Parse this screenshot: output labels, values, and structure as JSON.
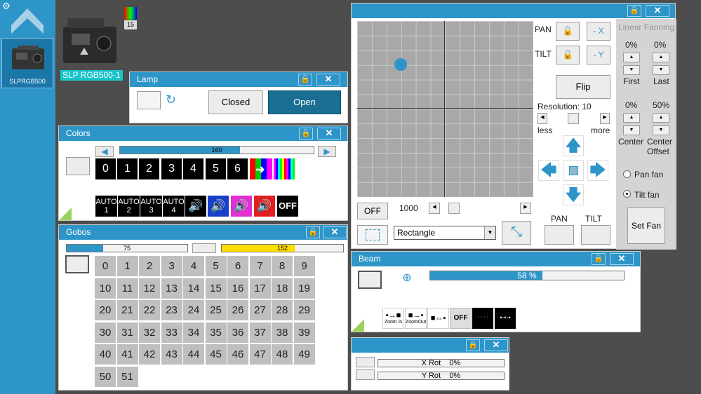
{
  "colors_theme": {
    "accent": "#2e95c8",
    "panel_bg": "#ffffff",
    "yellow": "#ffdd00",
    "dark_blue": "#1b6e93"
  },
  "sidebar": {
    "fixture_label": "SLPRGB500"
  },
  "fixture": {
    "name": "SLP RGB500-1",
    "channel": "15"
  },
  "lamp": {
    "title": "Lamp",
    "closed_label": "Closed",
    "open_label": "Open"
  },
  "colors": {
    "title": "Colors",
    "slider_value": "160",
    "slider_level": 0.62,
    "buttons": [
      "0",
      "1",
      "2",
      "3",
      "4",
      "5",
      "6"
    ],
    "auto_buttons": [
      {
        "top": "AUTO",
        "bottom": "1"
      },
      {
        "top": "AUTO",
        "bottom": "2"
      },
      {
        "top": "AUTO",
        "bottom": "3"
      },
      {
        "top": "AUTO",
        "bottom": "4"
      }
    ],
    "off_label": "OFF"
  },
  "gobos": {
    "title": "Gobos",
    "slider1_value": "75",
    "slider1_level": 0.3,
    "slider2_value": "152",
    "slider2_level": 0.6,
    "items": [
      "0",
      "1",
      "2",
      "3",
      "4",
      "5",
      "6",
      "7",
      "8",
      "9",
      "10",
      "11",
      "12",
      "13",
      "14",
      "15",
      "16",
      "17",
      "18",
      "19",
      "20",
      "21",
      "22",
      "23",
      "24",
      "25",
      "26",
      "27",
      "28",
      "29",
      "30",
      "31",
      "32",
      "33",
      "34",
      "35",
      "36",
      "37",
      "38",
      "39",
      "40",
      "41",
      "42",
      "43",
      "44",
      "45",
      "46",
      "47",
      "48",
      "49",
      "50",
      "51"
    ]
  },
  "position": {
    "pan_label": "PAN",
    "tilt_label": "TILT",
    "invert_x_label": "- X",
    "invert_y_label": "- Y",
    "flip_label": "Flip",
    "resolution_label": "Resolution: 10",
    "less_label": "less",
    "more_label": "more",
    "off_label": "OFF",
    "speed_value": "1000",
    "shape_selected": "Rectangle",
    "pan_button_label": "PAN",
    "tilt_button_label": "TILT"
  },
  "fanning": {
    "title": "Linear Fanning",
    "first_value": "0%",
    "first_label": "First",
    "last_value": "0%",
    "last_label": "Last",
    "center_value": "0%",
    "center_label": "Center",
    "center_offset_value": "50%",
    "center_offset_label": "Center Offset",
    "pan_fan_label": "Pan fan",
    "tilt_fan_label": "Tilt fan",
    "set_fan_label": "Set Fan"
  },
  "beam": {
    "title": "Beam",
    "zoom_value": "58 %",
    "zoom_level": 0.58,
    "zoom_in_label": "Zoom in",
    "zoom_out_label": "ZoomOut",
    "off_label": "OFF"
  },
  "rotation": {
    "x_rot_label": "X Rot",
    "x_rot_value": "0%",
    "y_rot_label": "Y Rot",
    "y_rot_value": "0%"
  }
}
